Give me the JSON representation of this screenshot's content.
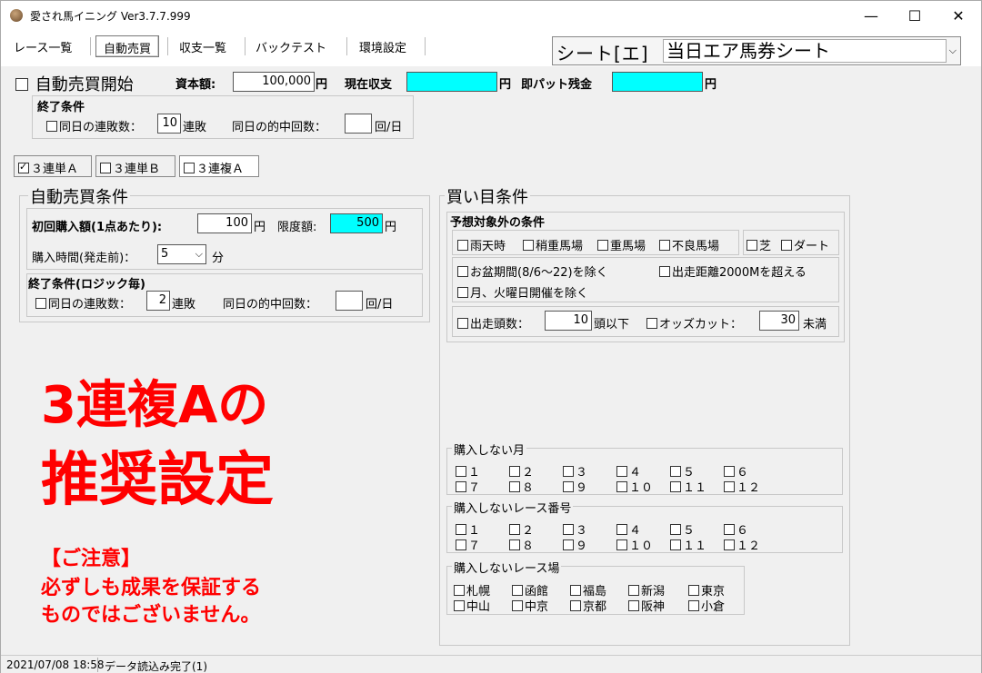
{
  "window": {
    "title": "愛され馬イニング Ver3.7.7.999",
    "minimize": "—",
    "maximize": "☐",
    "close": "✕"
  },
  "tabs": [
    "レース一覧",
    "自動売買",
    "収支一覧",
    "バックテスト",
    "環境設定"
  ],
  "sheet": {
    "label": "シート[エ]",
    "value": "当日エア馬券シート"
  },
  "top": {
    "auto_trade_label": "自動売買開始",
    "capital_label": "資本額:",
    "capital_value": "100,000",
    "yen1": "円",
    "balance_label": "現在収支",
    "yen2": "円",
    "ipat_label": "即パット残金",
    "yen3": "円"
  },
  "end_cond_top": {
    "title": "終了条件",
    "consec_loss_label": "同日の連敗数：",
    "consec_loss_value": "10",
    "consec_loss_unit": "連敗",
    "hit_label": "同日の的中回数：",
    "hit_value": "",
    "hit_unit": "回/日"
  },
  "bet_types": [
    {
      "label": "３連単Ａ",
      "checked": true
    },
    {
      "label": "３連単Ｂ",
      "checked": false
    },
    {
      "label": "３連複Ａ",
      "checked": false
    }
  ],
  "auto_cond": {
    "title": "自動売買条件",
    "first_buy_label": "初回購入額(1点あたり):",
    "first_buy_value": "100",
    "yen": "円",
    "limit_label": "限度額:",
    "limit_value": "500",
    "limit_yen": "円",
    "time_label": "購入時間(発走前)：",
    "time_value": "5",
    "time_unit": "分",
    "end_title": "終了条件(ロジック毎)",
    "consec_loss_label": "同日の連敗数：",
    "consec_loss_value": "2",
    "consec_loss_unit": "連敗",
    "hit_label": "同日の的中回数：",
    "hit_value": "",
    "hit_unit": "回/日"
  },
  "buy_cond": {
    "title": "買い目条件",
    "excl_title": "予想対象外の条件",
    "weather": [
      "雨天時",
      "稍重馬場",
      "重馬場",
      "不良馬場"
    ],
    "surface": [
      "芝",
      "ダート"
    ],
    "obon": "お盆期間(8/6〜22)を除く",
    "distance": "出走距離2000Mを超える",
    "monday": "月、火曜日開催を除く",
    "runners_label": "出走頭数：",
    "runners_value": "10",
    "runners_unit": "頭以下",
    "odds_label": "オッズカット：",
    "odds_value": "30",
    "odds_unit": "未満"
  },
  "no_month": {
    "title": "購入しない月",
    "items": [
      "１",
      "２",
      "３",
      "４",
      "５",
      "６",
      "７",
      "８",
      "９",
      "１０",
      "１１",
      "１２"
    ]
  },
  "no_race": {
    "title": "購入しないレース番号",
    "items": [
      "１",
      "２",
      "３",
      "４",
      "５",
      "６",
      "７",
      "８",
      "９",
      "１０",
      "１１",
      "１２"
    ]
  },
  "no_track": {
    "title": "購入しないレース場",
    "items": [
      "札幌",
      "函館",
      "福島",
      "新潟",
      "東京",
      "中山",
      "中京",
      "京都",
      "阪神",
      "小倉"
    ]
  },
  "overlay": {
    "line1": "3連複Aの",
    "line2": "推奨設定",
    "note1": "【ご注意】",
    "note2": "必ずしも成果を保証する",
    "note3": "ものではございません。"
  },
  "status": {
    "datetime": "2021/07/08 18:58",
    "message": "データ読込み完了(1)"
  }
}
